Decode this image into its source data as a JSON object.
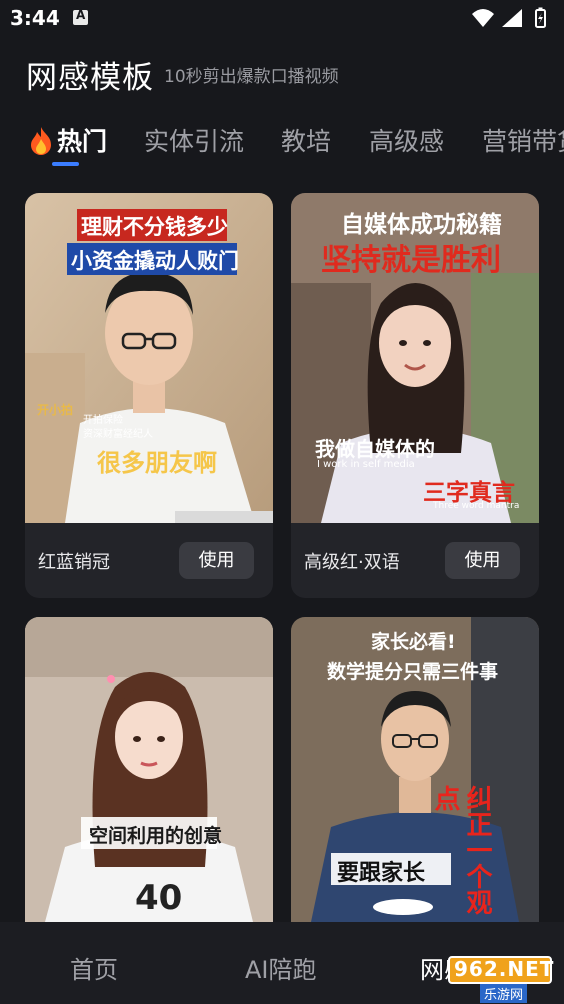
{
  "status_bar": {
    "time": "3:44",
    "notification_icon": "a-icon",
    "icons": [
      "wifi-icon",
      "signal-icon",
      "battery-icon"
    ]
  },
  "header": {
    "title": "网感模板",
    "subtitle": "10秒剪出爆款口播视频"
  },
  "tabs": [
    {
      "label": "热门",
      "active": true
    },
    {
      "label": "实体引流"
    },
    {
      "label": "教培"
    },
    {
      "label": "高级感"
    },
    {
      "label": "营销带货"
    }
  ],
  "cards": [
    {
      "name": "红蓝销冠",
      "button": "使用",
      "captions": {
        "line1": "理财不分钱多少",
        "line2": "小资金撬动人败门",
        "tag": "开小拍",
        "small1": "开拍保险",
        "small2": "资深财富经纪人",
        "bottom": "很多朋友啊"
      }
    },
    {
      "name": "高级红·双语",
      "button": "使用",
      "captions": {
        "line1": "自媒体成功秘籍",
        "line2": "坚持就是胜利",
        "mid": "我做自媒体的",
        "mid_en": "I work in self media",
        "bottom": "三字真言",
        "bottom_en": "Three word mantra"
      }
    },
    {
      "captions": {
        "bottom": "空间利用的创意"
      }
    },
    {
      "captions": {
        "line1": "家长必看!",
        "line2": "数学提分只需三件事",
        "side": "纠正一个观点",
        "bottom": "要跟家长"
      }
    }
  ],
  "bottom_nav": [
    {
      "label": "首页"
    },
    {
      "label": "AI陪跑"
    },
    {
      "label": "网感模板",
      "active": true
    }
  ],
  "watermark": {
    "text": "962.NET",
    "sub": "乐游网"
  },
  "colors": {
    "background": "#17181c",
    "card": "#232429",
    "accent": "#3b7dff",
    "tab_inactive": "#9fa0a6"
  }
}
